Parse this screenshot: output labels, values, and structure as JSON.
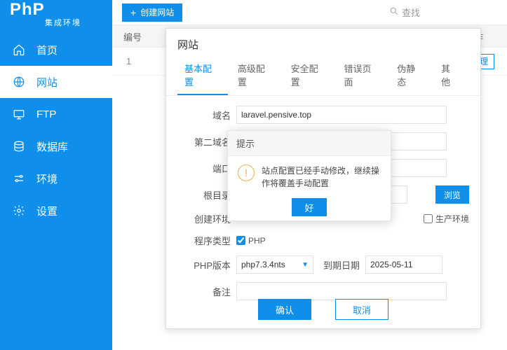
{
  "brand": {
    "title": "PhP",
    "sub": "集成环境"
  },
  "nav": {
    "items": [
      {
        "label": "首页"
      },
      {
        "label": "网站"
      },
      {
        "label": "FTP"
      },
      {
        "label": "数据库"
      },
      {
        "label": "环境"
      },
      {
        "label": "设置"
      }
    ]
  },
  "toolbar": {
    "create_label": "创建网站",
    "search_label": "查找"
  },
  "grid": {
    "col_num": "编号",
    "col_op": "操作",
    "row1": "1",
    "row1_op": "管理"
  },
  "modal": {
    "title": "网站",
    "tabs": [
      "基本配置",
      "高级配置",
      "安全配置",
      "错误页面",
      "伪静态",
      "其他"
    ],
    "labels": {
      "domain": "域名",
      "domain2": "第二域名",
      "port": "端口",
      "root": "根目录",
      "env": "创建环境",
      "ptype": "程序类型",
      "phpver": "PHP版本",
      "expire": "到期日期",
      "note": "备注"
    },
    "values": {
      "domain": "laravel.pensive.top",
      "php_checkbox": "PHP",
      "phpver": "php7.3.4nts",
      "expire": "2025-05-11"
    },
    "browse": "浏览",
    "prod_env": "生产环境",
    "ok": "确认",
    "cancel": "取消"
  },
  "alert": {
    "title": "提示",
    "msg": "站点配置已经手动修改，继续操作将覆盖手动配置",
    "ok": "好"
  }
}
